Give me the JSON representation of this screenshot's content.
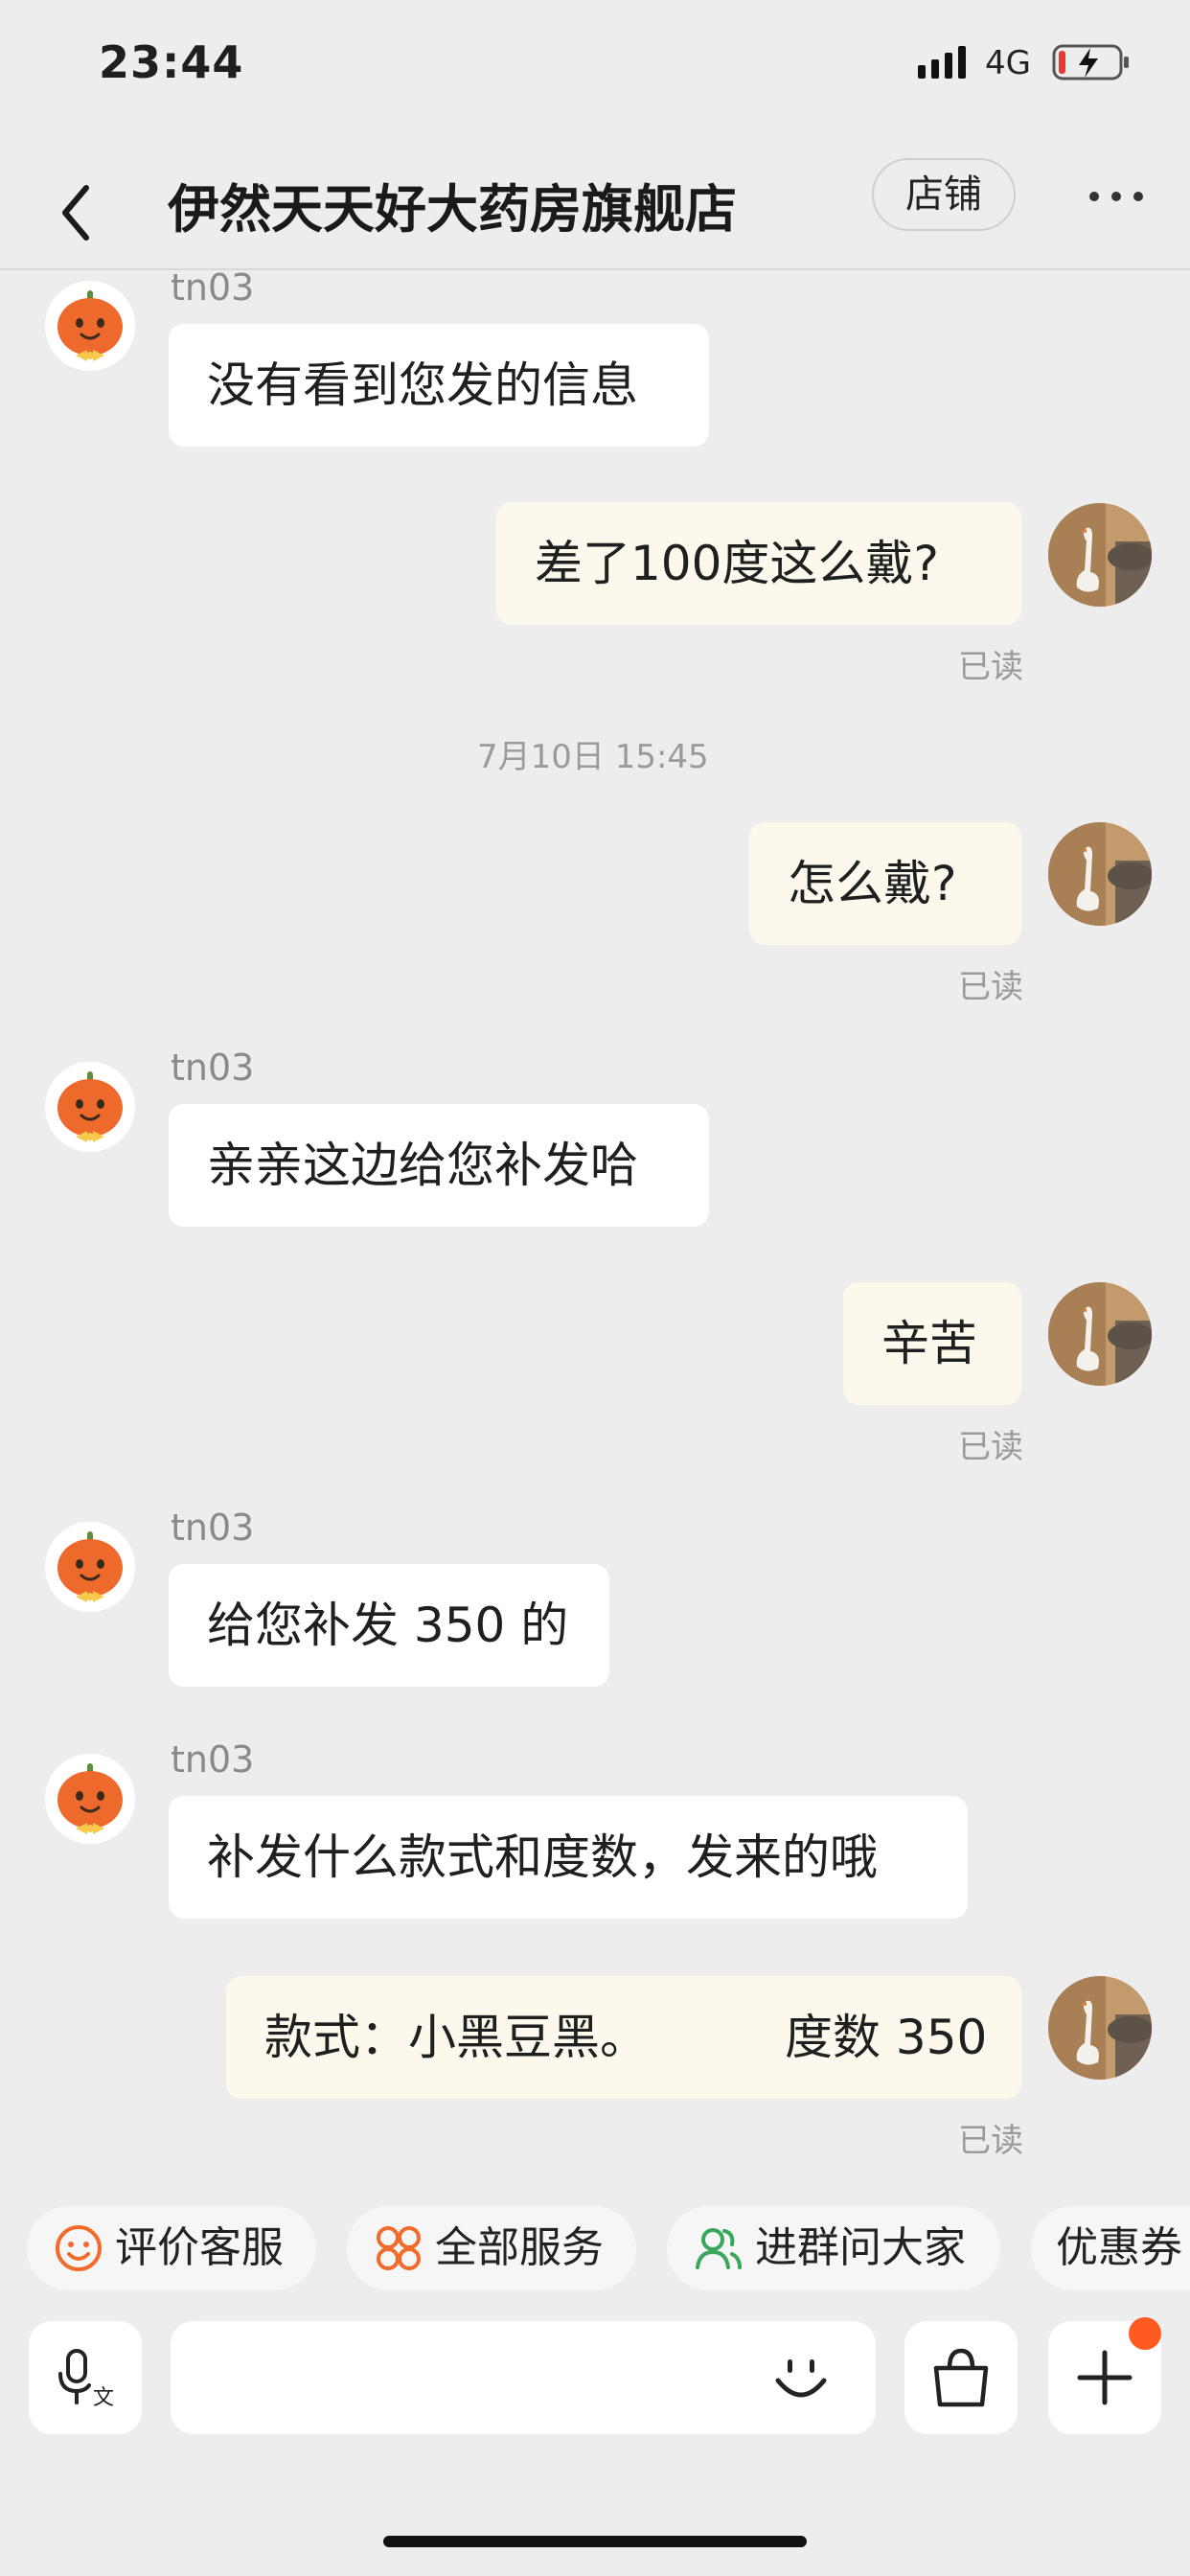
{
  "status": {
    "time": "23:44",
    "network": "4G"
  },
  "header": {
    "title": "伊然天天好大药房旗舰店",
    "shop_button": "店铺"
  },
  "messages": {
    "m1": {
      "sender": "tn03",
      "text": "没有看到您发的信息"
    },
    "m2": {
      "text": "差了100度这么戴?",
      "read": "已读"
    },
    "time1": "7月10日 15:45",
    "m3": {
      "text": "怎么戴?",
      "read": "已读"
    },
    "m4": {
      "sender": "tn03",
      "text": "亲亲这边给您补发哈"
    },
    "m5": {
      "text": "辛苦",
      "read": "已读"
    },
    "m6": {
      "sender": "tn03",
      "text": "给您补发 350 的"
    },
    "m7": {
      "sender": "tn03",
      "text": "补发什么款式和度数，发来的哦"
    },
    "m8": {
      "text": "款式：小黑豆黑。         度数 350",
      "read": "已读"
    }
  },
  "quick_actions": [
    {
      "label": "评价客服",
      "icon": "smile-icon",
      "color": "#f26b2a"
    },
    {
      "label": "全部服务",
      "icon": "services-icon",
      "color": "#f26b2a"
    },
    {
      "label": "进群问大家",
      "icon": "group-icon",
      "color": "#3aa65c"
    },
    {
      "label": "优惠券"
    }
  ],
  "colors": {
    "accent": "#ff5a1f",
    "outgoing_bubble": "#fcf8ec",
    "background": "#ededed"
  }
}
